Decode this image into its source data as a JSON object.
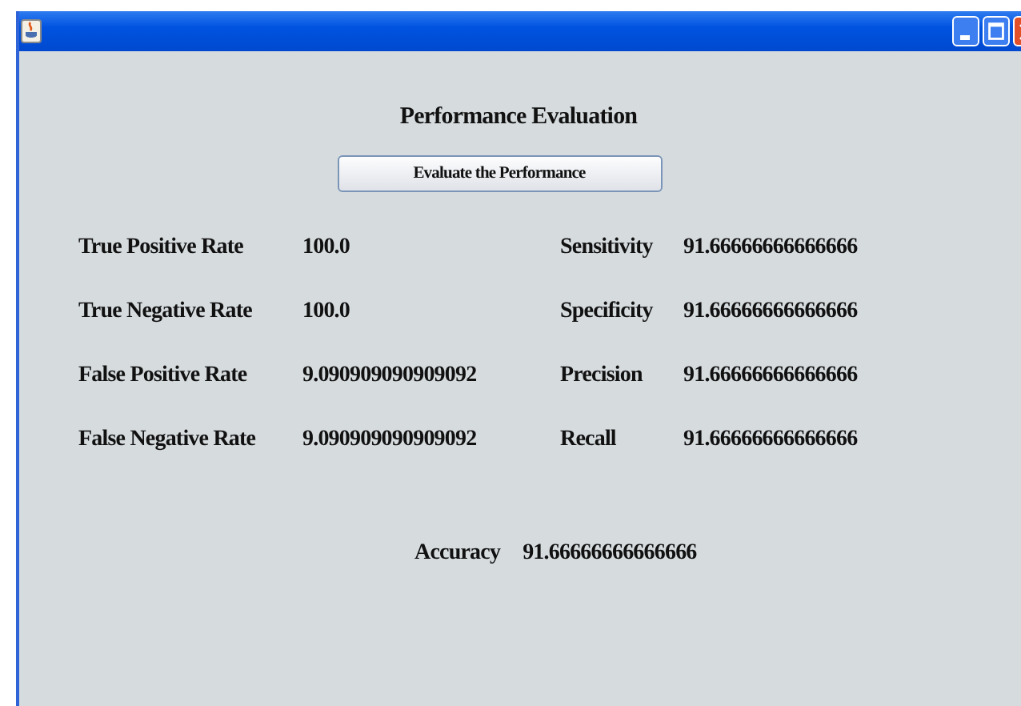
{
  "title": "Performance Evaluation",
  "button": "Evaluate the Performance",
  "rows": [
    {
      "left_label": "True Positive Rate",
      "left_value": "100.0",
      "right_label": "Sensitivity",
      "right_value": "91.66666666666666"
    },
    {
      "left_label": "True Negative Rate",
      "left_value": "100.0",
      "right_label": "Specificity",
      "right_value": "91.66666666666666"
    },
    {
      "left_label": "False Positive Rate",
      "left_value": "9.090909090909092",
      "right_label": "Precision",
      "right_value": "91.66666666666666"
    },
    {
      "left_label": "False Negative Rate",
      "left_value": "9.090909090909092",
      "right_label": "Recall",
      "right_value": "91.66666666666666"
    }
  ],
  "accuracy": {
    "label": "Accuracy",
    "value": "91.66666666666666"
  }
}
